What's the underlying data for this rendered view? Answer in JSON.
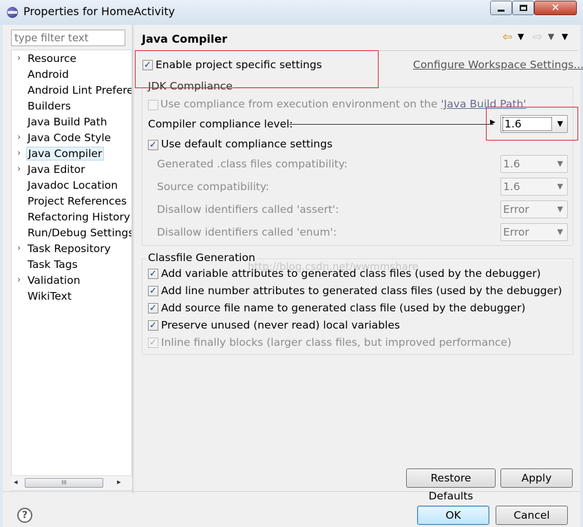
{
  "window": {
    "title": "Properties for HomeActivity"
  },
  "filter": {
    "placeholder": "type filter text"
  },
  "tree": {
    "items": [
      {
        "label": "Resource",
        "expandable": true
      },
      {
        "label": "Android",
        "expandable": false
      },
      {
        "label": "Android Lint Prefere",
        "expandable": false
      },
      {
        "label": "Builders",
        "expandable": false
      },
      {
        "label": "Java Build Path",
        "expandable": false
      },
      {
        "label": "Java Code Style",
        "expandable": true
      },
      {
        "label": "Java Compiler",
        "expandable": true,
        "selected": true
      },
      {
        "label": "Java Editor",
        "expandable": true
      },
      {
        "label": "Javadoc Location",
        "expandable": false
      },
      {
        "label": "Project References",
        "expandable": false
      },
      {
        "label": "Refactoring History",
        "expandable": false
      },
      {
        "label": "Run/Debug Settings",
        "expandable": false
      },
      {
        "label": "Task Repository",
        "expandable": true
      },
      {
        "label": "Task Tags",
        "expandable": false
      },
      {
        "label": "Validation",
        "expandable": true
      },
      {
        "label": "WikiText",
        "expandable": false
      }
    ]
  },
  "page": {
    "title": "Java Compiler",
    "enable_specific": {
      "label": "Enable project specific settings",
      "checked": true
    },
    "configure_link": "Configure Workspace Settings...",
    "jdk_compliance": {
      "title": "JDK Compliance",
      "use_env": {
        "label_prefix": "Use compliance from execution environment on the ",
        "link": "'Java Build Path'",
        "checked": false
      },
      "level": {
        "label": "Compiler compliance level:",
        "value": "1.6"
      },
      "use_default": {
        "label": "Use default compliance settings",
        "checked": true
      },
      "generated": {
        "label": "Generated .class files compatibility:",
        "value": "1.6"
      },
      "source": {
        "label": "Source compatibility:",
        "value": "1.6"
      },
      "assert": {
        "label": "Disallow identifiers called 'assert':",
        "value": "Error"
      },
      "enum": {
        "label": "Disallow identifiers called 'enum':",
        "value": "Error"
      }
    },
    "classfile": {
      "title": "Classfile Generation",
      "watermark": "http://blog.csdn.net/wwmmshare",
      "options": [
        {
          "label": "Add variable attributes to generated class files (used by the debugger)",
          "checked": true,
          "enabled": true
        },
        {
          "label": "Add line number attributes to generated class files (used by the debugger)",
          "checked": true,
          "enabled": true
        },
        {
          "label": "Add source file name to generated class file (used by the debugger)",
          "checked": true,
          "enabled": true
        },
        {
          "label": "Preserve unused (never read) local variables",
          "checked": true,
          "enabled": true
        },
        {
          "label": "Inline finally blocks (larger class files, but improved performance)",
          "checked": true,
          "enabled": false
        }
      ]
    },
    "buttons": {
      "restore": "Restore Defaults",
      "apply": "Apply"
    }
  },
  "footer": {
    "ok": "OK",
    "cancel": "Cancel"
  },
  "colors": {
    "highlight_box": "#d9252a",
    "link": "#555555",
    "selection": "#e5f3fb"
  }
}
